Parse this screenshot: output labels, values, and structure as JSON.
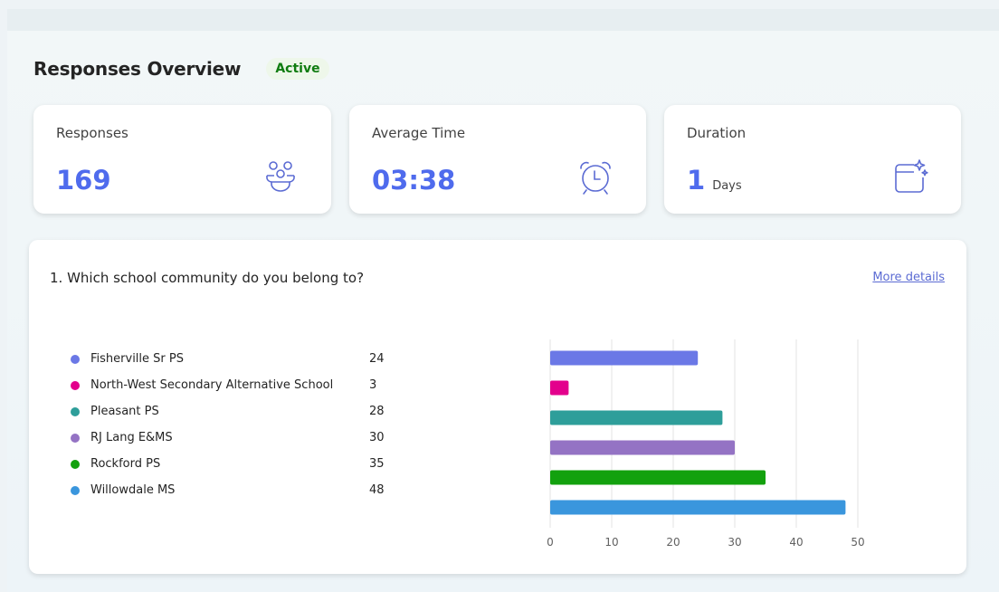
{
  "header": {
    "title": "Responses Overview",
    "status": "Active"
  },
  "stats": {
    "responses": {
      "label": "Responses",
      "value": "169",
      "icon": "people-icon"
    },
    "average_time": {
      "label": "Average Time",
      "value": "03:38",
      "icon": "alarm-clock-icon"
    },
    "duration": {
      "label": "Duration",
      "value": "1",
      "unit": "Days",
      "icon": "calendar-sparkle-icon"
    }
  },
  "question": {
    "text": "1. Which school community do you belong to?",
    "more_link": "More details"
  },
  "chart_data": {
    "type": "bar",
    "orientation": "horizontal",
    "categories": [
      "Fisherville Sr PS",
      "North-West Secondary Alternative School",
      "Pleasant PS",
      "RJ Lang E&MS",
      "Rockford PS",
      "Willowdale MS"
    ],
    "values": [
      24,
      3,
      28,
      30,
      35,
      48
    ],
    "colors": [
      "#6b78e6",
      "#e3008c",
      "#2e9e9a",
      "#9473c4",
      "#13a10e",
      "#3a96dd"
    ],
    "xlim": [
      0,
      50
    ],
    "xticks": [
      "0",
      "10",
      "20",
      "30",
      "40",
      "50"
    ],
    "grid": true,
    "legend_placement": "left"
  }
}
